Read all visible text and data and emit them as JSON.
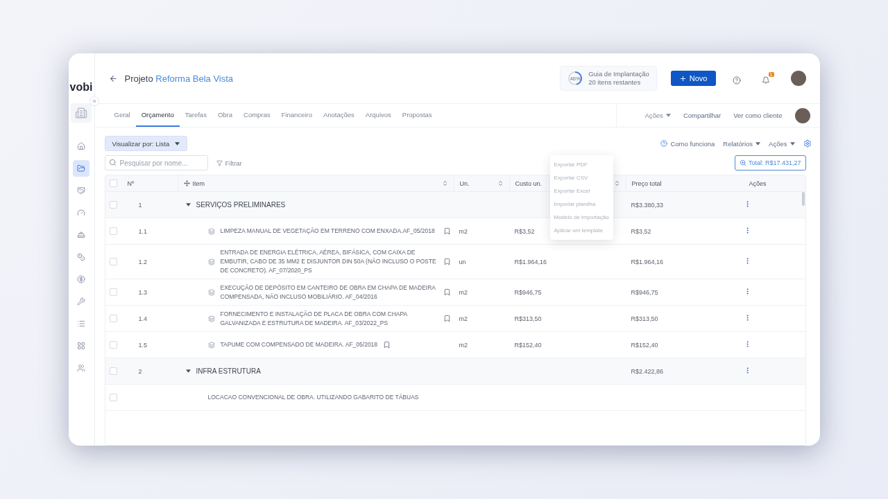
{
  "brand": "vobi",
  "sidebar": {
    "items": [
      {
        "selected": false
      },
      {
        "selected": true
      },
      {
        "selected": false
      },
      {
        "selected": false
      },
      {
        "selected": false
      },
      {
        "selected": false
      },
      {
        "selected": false
      },
      {
        "selected": false
      },
      {
        "selected": false
      },
      {
        "selected": false
      },
      {
        "selected": false
      }
    ]
  },
  "header": {
    "prefix": "Projeto",
    "project": "Reforma Bela Vista",
    "guide": {
      "percent": "46%",
      "level": 0.46,
      "title": "Guia de Implantação",
      "subtitle": "20 itens restantes"
    },
    "new_button": "Novo",
    "notifications": "1"
  },
  "tabs": [
    {
      "label": "Geral",
      "selected": false
    },
    {
      "label": "Orçamento",
      "selected": true
    },
    {
      "label": "Tarefas",
      "selected": false
    },
    {
      "label": "Obra",
      "selected": false
    },
    {
      "label": "Compras",
      "selected": false
    },
    {
      "label": "Financeiro",
      "selected": false
    },
    {
      "label": "Anotações",
      "selected": false
    },
    {
      "label": "Arquivos",
      "selected": false
    },
    {
      "label": "Propostas",
      "selected": false
    }
  ],
  "tab_actions": {
    "actions": "Ações",
    "share": "Compartilhar",
    "view_as_client": "Ver como cliente"
  },
  "toolbar": {
    "view_select": "Visualizar por: Lista",
    "help": "Como funciona",
    "reports": "Relatórios",
    "actions": "Ações",
    "search_placeholder": "Pesquisar por nome...",
    "filter": "Filtrar",
    "total": "Total: R$17.431,27"
  },
  "actions_menu": [
    "Exportar PDF",
    "Exportar CSV",
    "Exportar Excel",
    "Importar planilha",
    "Modelo de importação",
    "Aplicar um template"
  ],
  "table": {
    "header_checked": false,
    "columns": [
      "Nº",
      "Item",
      "Un.",
      "Custo un.",
      "Preço total",
      "Ações"
    ],
    "rows": [
      {
        "kind": "group",
        "checked": false,
        "number": "1",
        "item": "SERVIÇOS PRELIMINARES",
        "total": "R$3.380,33"
      },
      {
        "kind": "item",
        "checked": false,
        "number": "1.1",
        "item": "LIMPEZA MANUAL DE VEGETAÇÃO EM TERRENO COM ENXADA.AF_05/2018",
        "unit": "m2",
        "cost": "R$3,52",
        "total": "R$3,52"
      },
      {
        "kind": "item",
        "checked": false,
        "number": "1.2",
        "item": "ENTRADA DE ENERGIA ELÉTRICA, AÉREA, BIFÁSICA, COM CAIXA DE EMBUTIR, CABO DE 35 MM2 E DISJUNTOR DIN 50A (NÃO INCLUSO O POSTE DE CONCRETO). AF_07/2020_PS",
        "unit": "un",
        "cost": "R$1.964,16",
        "total": "R$1.964,16"
      },
      {
        "kind": "item",
        "checked": false,
        "number": "1.3",
        "item": "EXECUÇÃO DE DEPÓSITO EM CANTEIRO DE OBRA EM CHAPA DE MADEIRA COMPENSADA, NÃO INCLUSO MOBILIÁRIO. AF_04/2016",
        "unit": "m2",
        "cost": "R$946,75",
        "total": "R$946,75"
      },
      {
        "kind": "item",
        "checked": false,
        "number": "1.4",
        "item": "FORNECIMENTO E INSTALAÇÃO DE PLACA DE OBRA COM CHAPA GALVANIZADA E ESTRUTURA DE MADEIRA. AF_03/2022_PS",
        "unit": "m2",
        "cost": "R$313,50",
        "total": "R$313,50"
      },
      {
        "kind": "item",
        "checked": false,
        "number": "1.5",
        "item": "TAPUME COM COMPENSADO DE MADEIRA. AF_05/2018",
        "unit": "m2",
        "cost": "R$152,40",
        "total": "R$152,40"
      },
      {
        "kind": "group",
        "checked": false,
        "number": "2",
        "item": "INFRA ESTRUTURA",
        "total": "R$2.422,86"
      },
      {
        "kind": "partial",
        "checked": false,
        "item": "LOCACAO CONVENCIONAL DE OBRA. UTILIZANDO GABARITO DE TÁBUAS"
      }
    ]
  }
}
